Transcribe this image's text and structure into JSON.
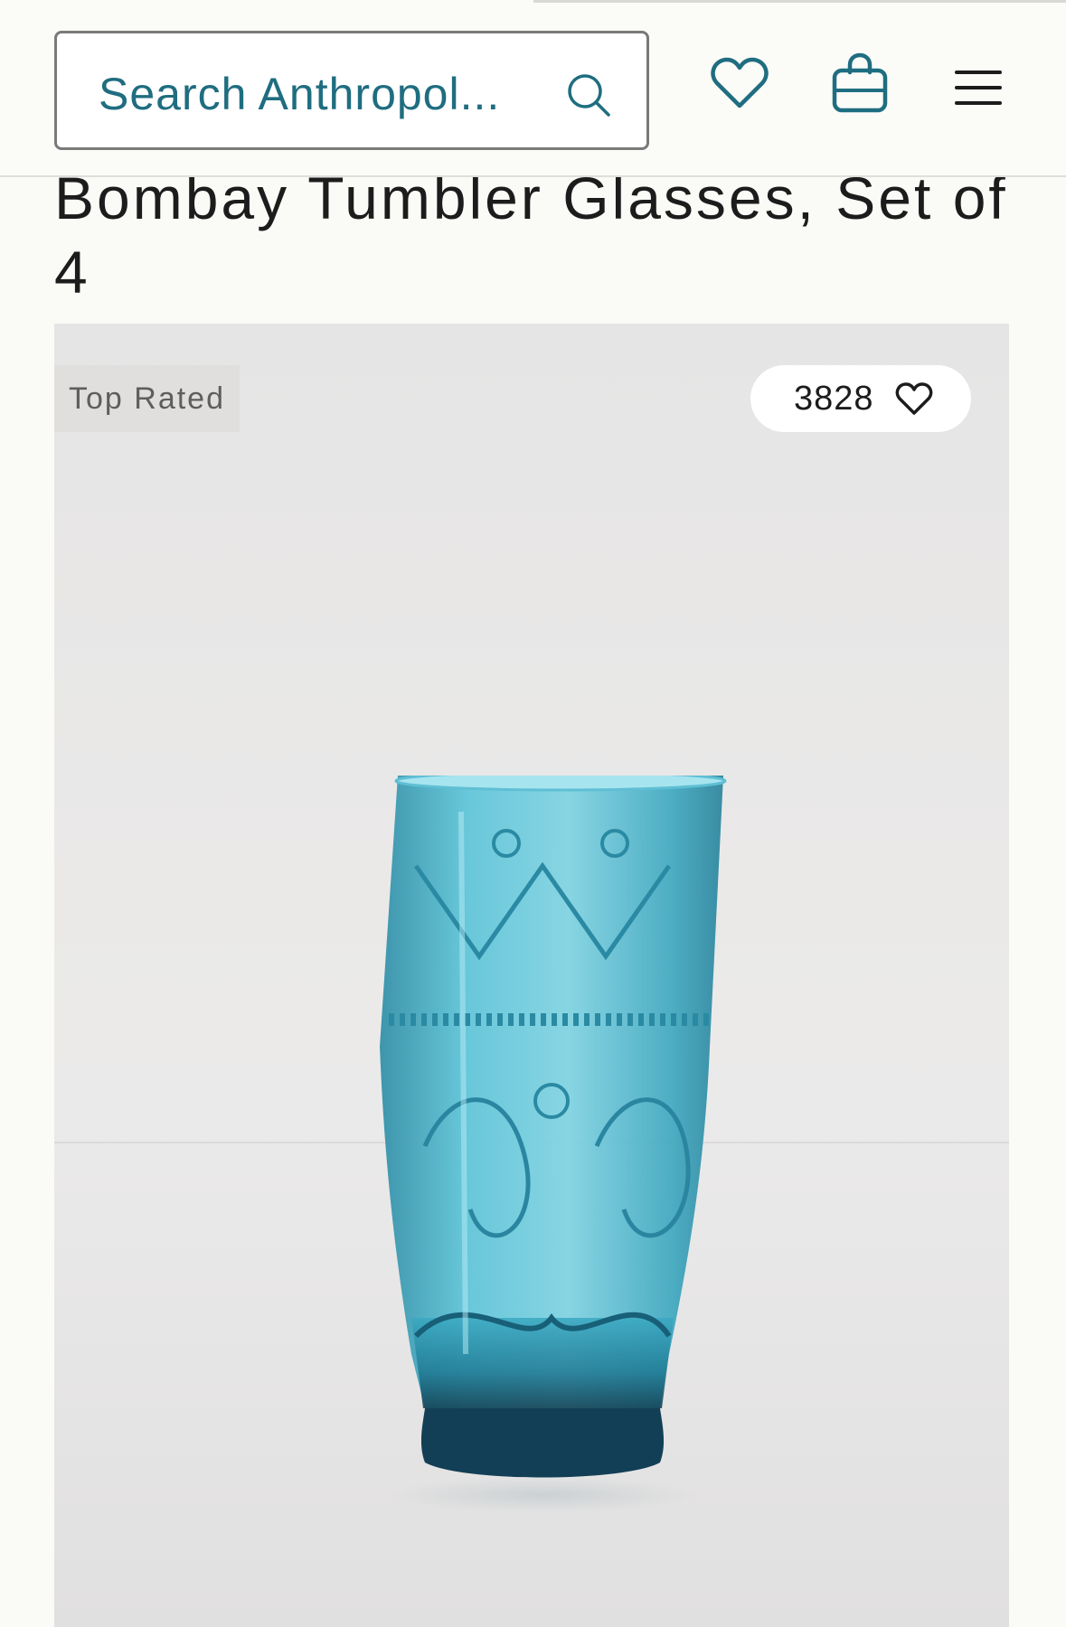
{
  "header": {
    "search_placeholder": "Search Anthropol...",
    "icons": {
      "search": "search-icon",
      "wishlist": "heart-icon",
      "bag": "shopping-bag-icon",
      "menu": "hamburger-menu-icon"
    }
  },
  "product": {
    "title": "Bombay Tumbler Glasses, Set of 4",
    "badge": "Top Rated",
    "favorites_count": "3828"
  },
  "colors": {
    "brand_teal": "#1f6d80",
    "text_dark": "#1c1c1c",
    "glass_blue": "#3ab0c8"
  }
}
